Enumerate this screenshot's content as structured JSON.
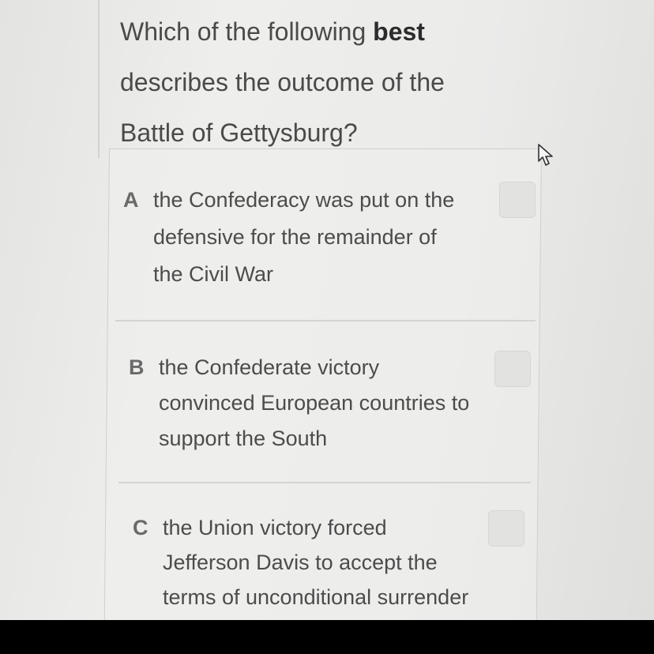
{
  "question": {
    "prefix": "Which of the following ",
    "emphasis": "best",
    "line2": "describes the outcome of the",
    "line3": "Battle of Gettysburg?"
  },
  "options": [
    {
      "letter": "A",
      "lines": [
        "the Confederacy was put on the",
        "defensive for the remainder of",
        "the Civil War"
      ]
    },
    {
      "letter": "B",
      "lines": [
        "the Confederate victory",
        "convinced European countries to",
        "support the South"
      ]
    },
    {
      "letter": "C",
      "lines": [
        "the Union victory forced",
        "Jefferson Davis to accept the",
        "terms of unconditional surrender"
      ]
    }
  ],
  "icons": {
    "cursor": "mouse-pointer-icon"
  }
}
